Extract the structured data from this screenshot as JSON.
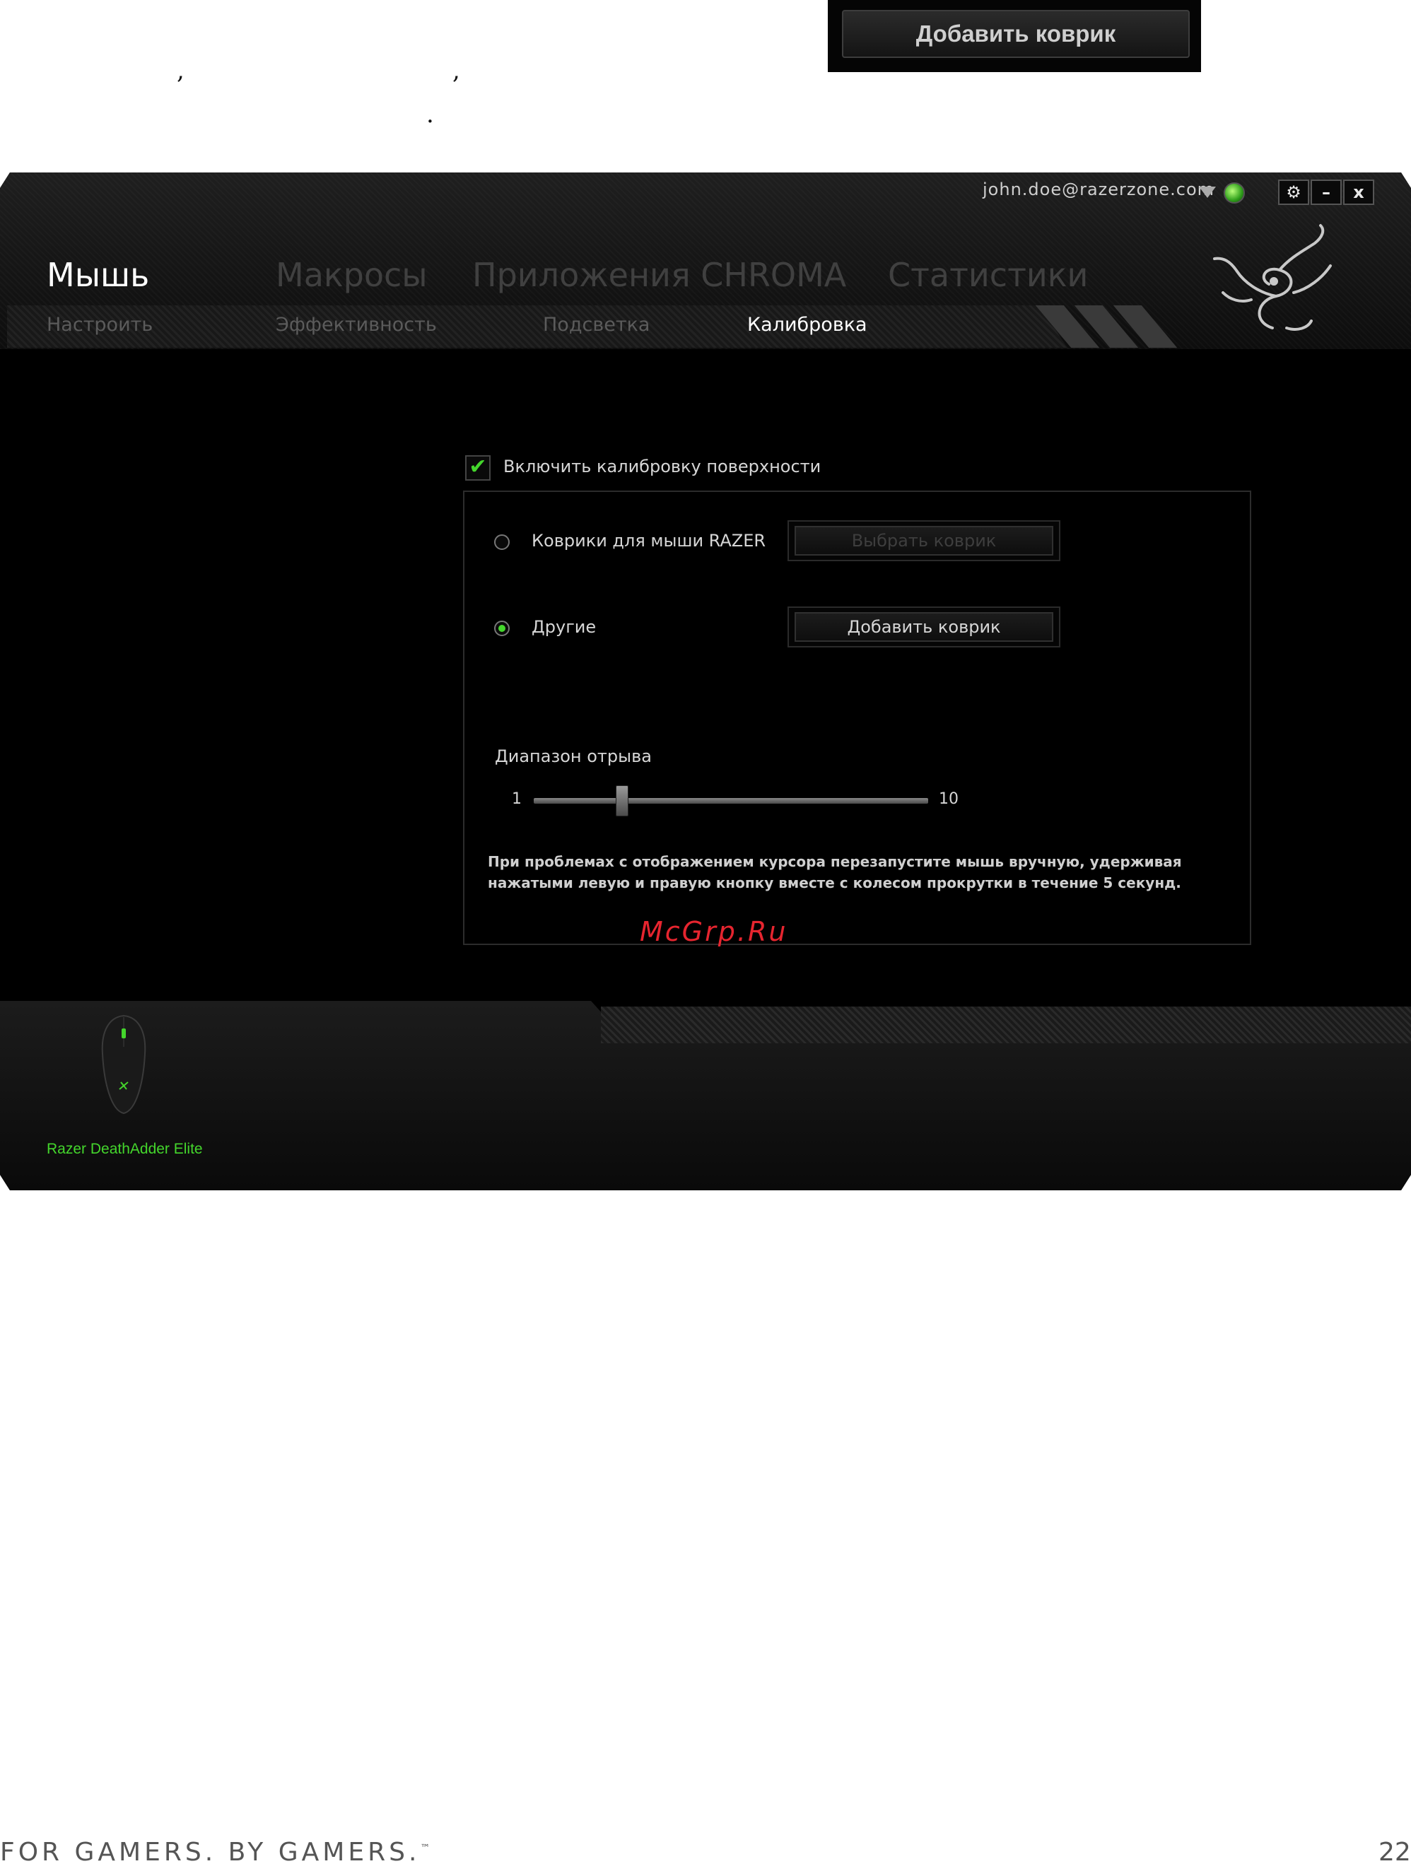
{
  "manual": {
    "marks": [
      ",",
      ",",
      "."
    ],
    "snippet_button_label": "Добавить коврик"
  },
  "window": {
    "user_email": "john.doe@razerzone.com",
    "controls": {
      "settings": "⚙",
      "minimize": "–",
      "close": "x"
    },
    "main_tabs": [
      {
        "label": "Мышь",
        "active": true
      },
      {
        "label": "Макросы",
        "active": false
      },
      {
        "label": "Приложения CHROMA",
        "active": false
      },
      {
        "label": "Статистики",
        "active": false
      }
    ],
    "sub_tabs": [
      {
        "label": "Настроить",
        "active": false
      },
      {
        "label": "Эффективность",
        "active": false
      },
      {
        "label": "Подсветка",
        "active": false
      },
      {
        "label": "Калибровка",
        "active": true
      }
    ]
  },
  "calibration": {
    "enable_label": "Включить калибровку поверхности",
    "enabled": true,
    "options": [
      {
        "label": "Коврики для мыши RAZER",
        "selected": false,
        "button": "Выбрать коврик",
        "button_enabled": false
      },
      {
        "label": "Другие",
        "selected": true,
        "button": "Добавить коврик",
        "button_enabled": true
      }
    ],
    "liftoff": {
      "label": "Диапазон отрыва",
      "min_label": "1",
      "max_label": "10",
      "value": 3
    },
    "hint_line1": "При проблемах с отображением курсора перезапустите мышь вручную, удерживая",
    "hint_line2": "нажатыми левую и правую кнопку вместе с колесом прокрутки в течение 5 секунд."
  },
  "watermark": "McGrp.Ru",
  "device": {
    "name": "Razer DeathAdder Elite"
  },
  "page": {
    "tagline": "FOR GAMERS. BY GAMERS.",
    "tm": "™",
    "number": "22"
  },
  "colors": {
    "accent": "#44d62c",
    "background": "#000000"
  }
}
